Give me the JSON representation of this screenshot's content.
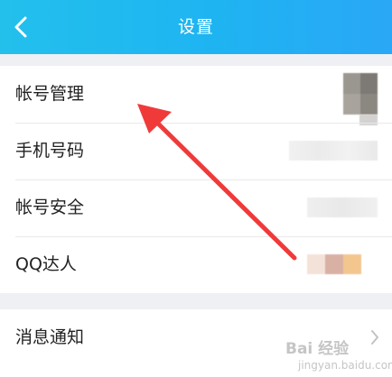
{
  "header": {
    "title": "设置",
    "back_icon": "chevron-left-icon"
  },
  "account_group": {
    "items": [
      {
        "label": "帐号管理"
      },
      {
        "label": "手机号码"
      },
      {
        "label": "帐号安全"
      },
      {
        "label": "QQ达人"
      }
    ]
  },
  "notification_group": {
    "items": [
      {
        "label": "消息通知",
        "icon": "chevron-right-icon"
      }
    ]
  },
  "annotation": {
    "icon": "red-arrow-icon",
    "color": "#f03a3a"
  },
  "watermark": {
    "main": "Bai 经验",
    "sub": "jingyan.baidu.com"
  },
  "colors": {
    "header_start": "#23c0ec",
    "header_end": "#2aa7f6",
    "background": "#eef0f4"
  }
}
